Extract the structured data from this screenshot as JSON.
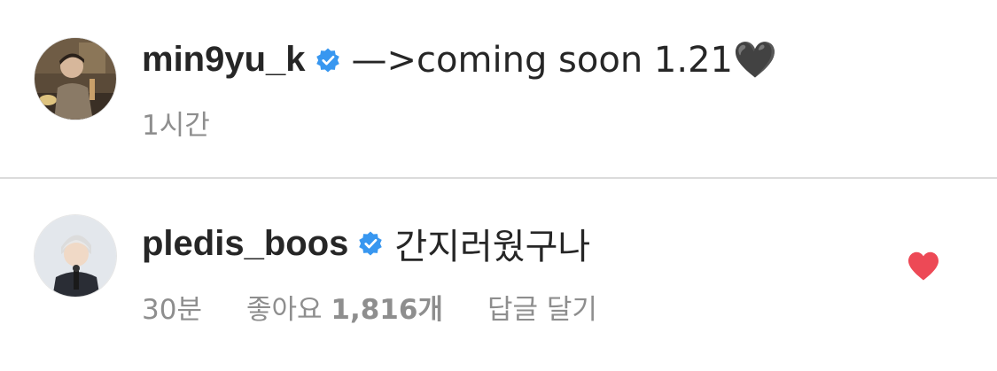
{
  "post": {
    "username": "min9yu_k",
    "caption": "—>coming soon 1.21🖤",
    "time": "1시간",
    "avatar_icon": "profile-photo",
    "verified_icon": "verified-badge-icon"
  },
  "reply": {
    "username": "pledis_boos",
    "text": "간지러웠구나",
    "time": "30분",
    "likes_label": "좋아요",
    "likes_count": "1,816개",
    "reply_label": "답글 달기",
    "liked": true,
    "avatar_icon": "profile-photo",
    "verified_icon": "verified-badge-icon"
  },
  "colors": {
    "text": "#262626",
    "meta": "#8e8e8e",
    "verified": "#3897f0",
    "heart": "#ed4956",
    "divider": "#dbdbdb"
  }
}
